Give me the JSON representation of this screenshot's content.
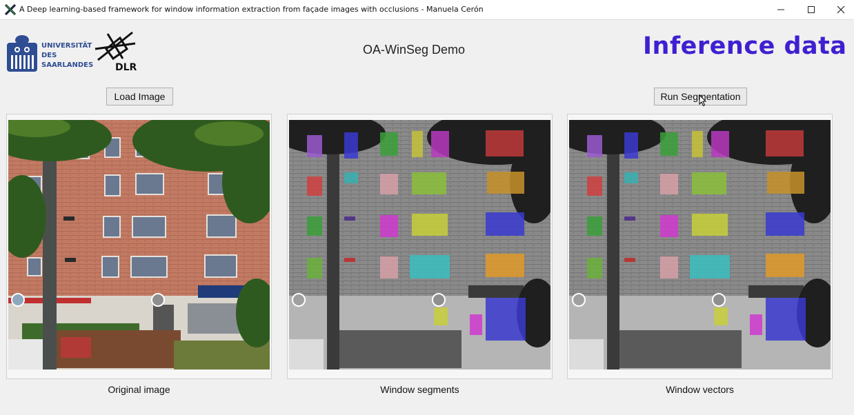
{
  "window": {
    "title": "A Deep learning-based framework for window information extraction from façade images with occlusions - Manuela Cerón",
    "app_icon": "x-app-icon"
  },
  "header": {
    "uni_line1": "UNIVERSITÄT",
    "uni_line2": "DES",
    "uni_line3": "SAARLANDES",
    "dlr_text": "DLR",
    "demo_title": "OA-WinSeg Demo",
    "inference_title": "Inference data"
  },
  "buttons": {
    "load_image": "Load Image",
    "run_segmentation": "Run Segmentation"
  },
  "panels": [
    {
      "caption": "Original image"
    },
    {
      "caption": "Window segments"
    },
    {
      "caption": "Window vectors"
    }
  ],
  "colors": {
    "inference_title": "#3f1fd1",
    "uni_blue": "#2f4d92",
    "background": "#f0f0f0"
  }
}
